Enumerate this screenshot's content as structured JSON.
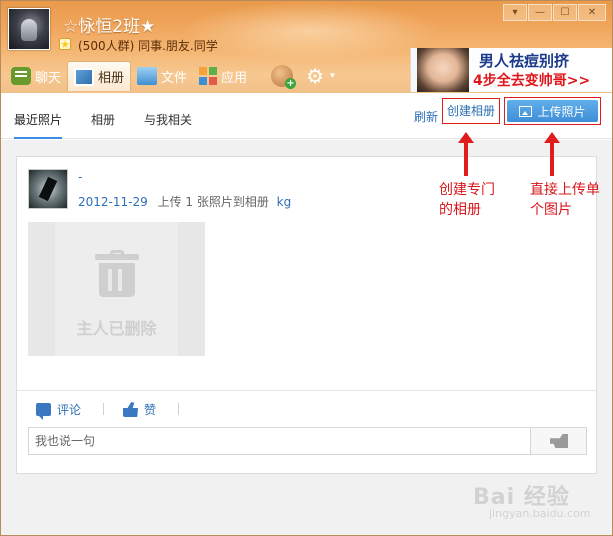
{
  "window": {
    "group_name": "☆怺恒2班★",
    "group_subtitle": "(500人群) 同事.朋友.同学",
    "controls": [
      "▾",
      "—",
      "☐",
      "✕"
    ]
  },
  "toolbar": {
    "items": [
      {
        "label": "聊天",
        "icon": "chat-icon"
      },
      {
        "label": "相册",
        "icon": "album-icon",
        "active": true
      },
      {
        "label": "文件",
        "icon": "folder-icon"
      },
      {
        "label": "应用",
        "icon": "apps-icon"
      }
    ],
    "extra_icons": [
      "add-friend-icon",
      "gear-icon"
    ]
  },
  "ad": {
    "line1": "男人祛痘别挤",
    "line2": "4步全去变帅哥>>"
  },
  "subnav": {
    "tabs": [
      "最近照片",
      "相册",
      "与我相关"
    ],
    "active_tab": "最近照片",
    "refresh": "刷新",
    "create_album": "创建相册",
    "upload": "上传照片"
  },
  "post": {
    "poster_name": "-",
    "date": "2012-11-29",
    "action_text": "上传 1 张照片到相册",
    "album_name": "kg",
    "deleted_text": "主人已删除",
    "comment_label": "评论",
    "like_label": "赞",
    "comment_placeholder": "我也说一句"
  },
  "annotations": {
    "create_note": [
      "创建专门",
      "的相册"
    ],
    "upload_note": [
      "直接上传单",
      "个图片"
    ]
  },
  "watermark": {
    "brand": "Bai 经验",
    "url": "jingyan.baidu.com"
  },
  "colors": {
    "accent_blue": "#3e8fd8",
    "link_blue": "#2d6fb5",
    "annotation_red": "#e01c1c",
    "header_orange": "#f0a45a"
  }
}
